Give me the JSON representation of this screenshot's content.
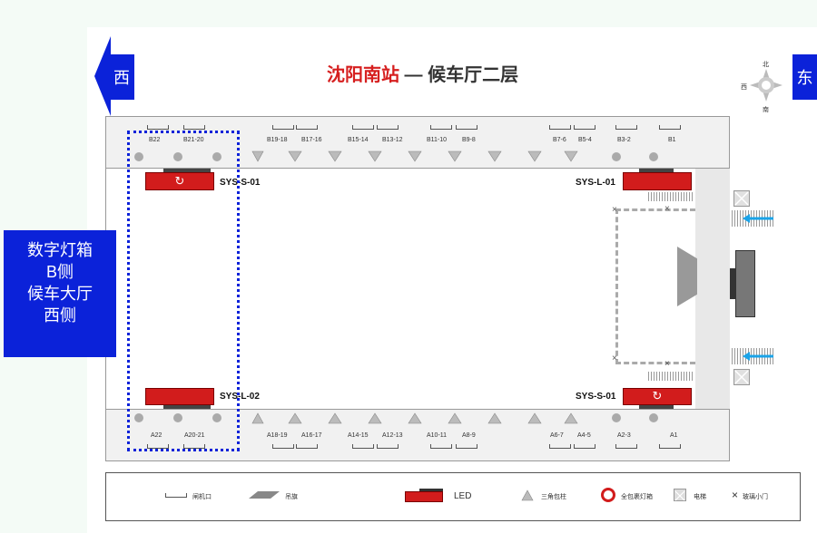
{
  "title": {
    "station": "沈阳南站",
    "dash": " — ",
    "floor": "候车厅二层"
  },
  "directions": {
    "west": "西",
    "east": "东"
  },
  "compass": {
    "north": "北",
    "west": "西",
    "south": "南"
  },
  "side_label": {
    "line1": "数字灯箱",
    "line2": "B侧",
    "line3": "候车大厅",
    "line4": "西侧"
  },
  "top_gates": [
    "B22",
    "B21-20",
    "B19-18",
    "B17-16",
    "B15-14",
    "B13-12",
    "B11-10",
    "B9-8",
    "B7-6",
    "B5-4",
    "B3-2",
    "B1"
  ],
  "bottom_gates": [
    "A22",
    "A20-21",
    "A18-19",
    "A16-17",
    "A14-15",
    "A12-13",
    "A10-11",
    "A8-9",
    "A6-7",
    "A4-5",
    "A2-3",
    "A1"
  ],
  "screens": {
    "sys_s_01_top": "SYS-S-01",
    "sys_l_01": "SYS-L-01",
    "sys_l_02": "SYS-L-02",
    "sys_s_01_bottom": "SYS-S-01"
  },
  "legend": {
    "gate": "闸机口",
    "flag": "吊旗",
    "led": "LED",
    "pillar": "三角包柱",
    "lightbox": "全包裹灯箱",
    "elevator": "电梯",
    "glass_door": "玻璃小门"
  },
  "colors": {
    "blue": "#0b22d9",
    "red": "#d21c1c",
    "arrow": "#1aa3e8"
  }
}
